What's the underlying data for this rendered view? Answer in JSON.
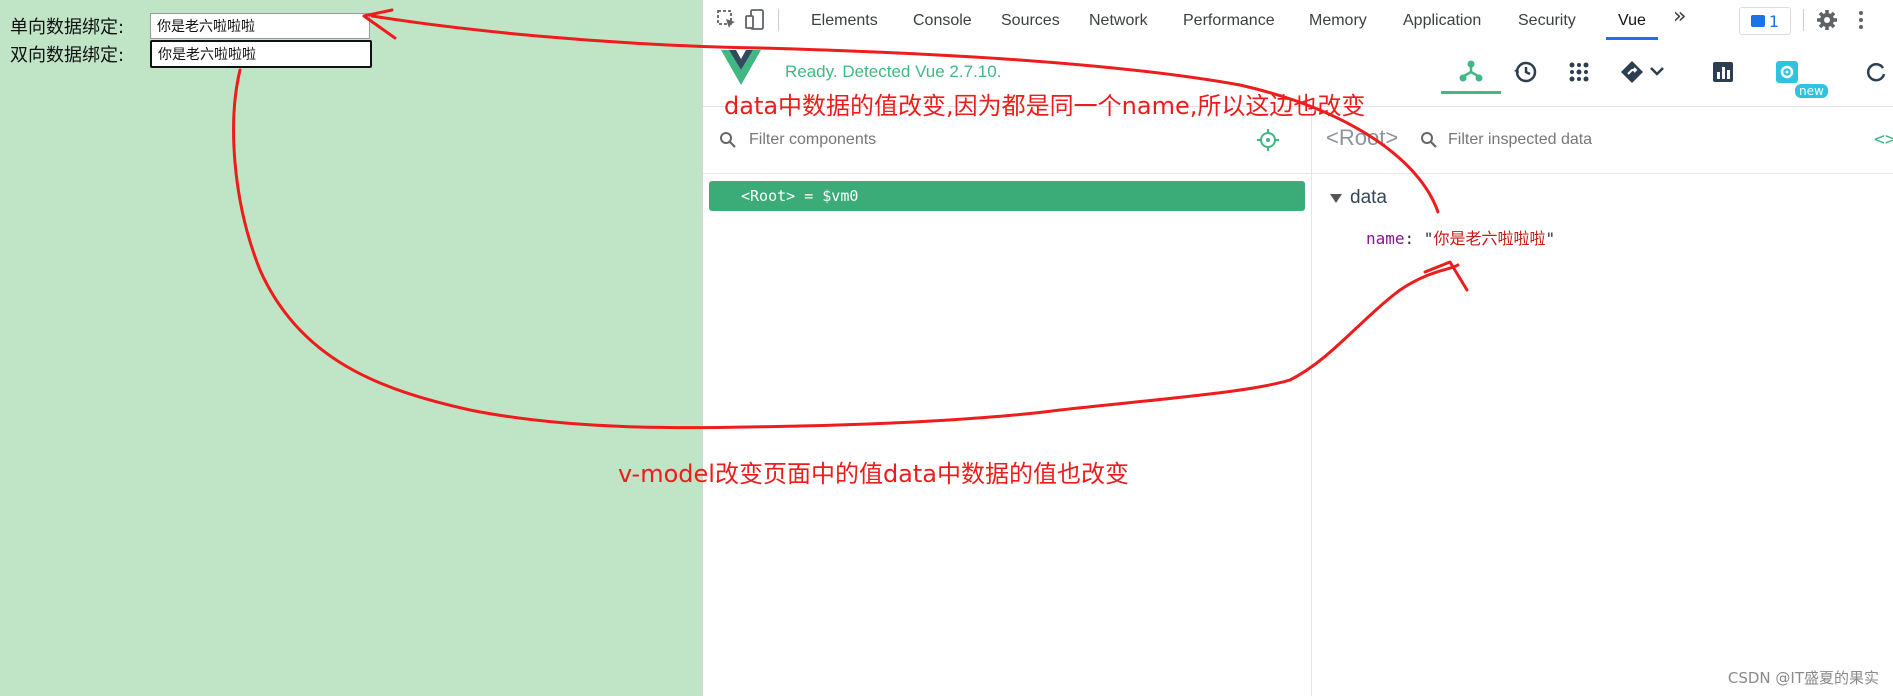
{
  "page": {
    "one_way_label": "单向数据绑定:",
    "one_way_value": "你是老六啦啦啦",
    "two_way_label": "双向数据绑定:",
    "two_way_value": "你是老六啦啦啦"
  },
  "devtools": {
    "tabs": [
      "Elements",
      "Console",
      "Sources",
      "Network",
      "Performance",
      "Memory",
      "Application",
      "Security",
      "Vue"
    ],
    "active_tab": "Vue",
    "more_tabs": "»",
    "issues_count": "1"
  },
  "vue": {
    "ready_text": "Ready. Detected Vue 2.7.10.",
    "new_badge": "new",
    "components_filter_placeholder": "Filter components",
    "root_row_tag": "<Root>",
    "root_row_vm": "= $vm0",
    "inspector_title": "<Root>",
    "inspected_filter_placeholder": "Filter inspected data",
    "code_toggle": "<>",
    "section_label": "data",
    "prop_key": "name",
    "prop_value": "你是老六啦啦啦"
  },
  "annotations": {
    "top_note": "data中数据的值改变,因为都是同一个name,所以这边也改变",
    "bottom_note": "v-model改变页面中的值data中数据的值也改变",
    "color": "#ee1c1c"
  },
  "watermark": "CSDN @IT盛夏的果实",
  "colors": {
    "page_bg": "#c0e5c6",
    "vue_green": "#41b883",
    "active_tab_underline": "#1a73e8",
    "root_row_bg": "#3bab77"
  }
}
